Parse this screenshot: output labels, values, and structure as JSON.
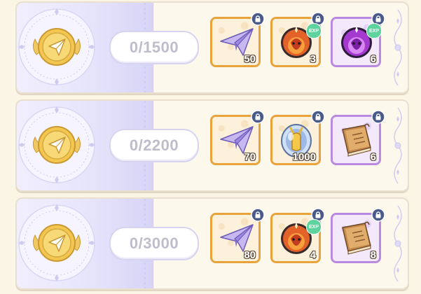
{
  "tiers": [
    {
      "progress": "0/1500",
      "rewards": [
        {
          "icon": "paper-plane-icon",
          "qty": "50",
          "frame": "orange",
          "exp": false
        },
        {
          "icon": "orange-exp-orb-icon",
          "qty": "3",
          "frame": "orange",
          "exp": true,
          "exp_label": "EXP"
        },
        {
          "icon": "purple-exp-orb-icon",
          "qty": "6",
          "frame": "purple",
          "exp": true,
          "exp_label": "EXP"
        }
      ]
    },
    {
      "progress": "0/2200",
      "rewards": [
        {
          "icon": "paper-plane-icon",
          "qty": "70",
          "frame": "orange",
          "exp": false
        },
        {
          "icon": "crystal-sphere-icon",
          "qty": "1000",
          "frame": "orange",
          "exp": false
        },
        {
          "icon": "skill-book-icon",
          "qty": "6",
          "frame": "purple",
          "exp": false
        }
      ]
    },
    {
      "progress": "0/3000",
      "rewards": [
        {
          "icon": "paper-plane-icon",
          "qty": "80",
          "frame": "orange",
          "exp": false
        },
        {
          "icon": "orange-exp-orb-icon",
          "qty": "4",
          "frame": "orange",
          "exp": true,
          "exp_label": "EXP"
        },
        {
          "icon": "skill-book-icon",
          "qty": "8",
          "frame": "purple",
          "exp": false
        }
      ]
    }
  ],
  "colors": {
    "orange_frame": "#e8a43b",
    "purple_frame": "#b98ae0",
    "lock_badge": "#4a5a8a",
    "exp_badge": "#5fd39e",
    "progress_text": "#bfbccb"
  }
}
